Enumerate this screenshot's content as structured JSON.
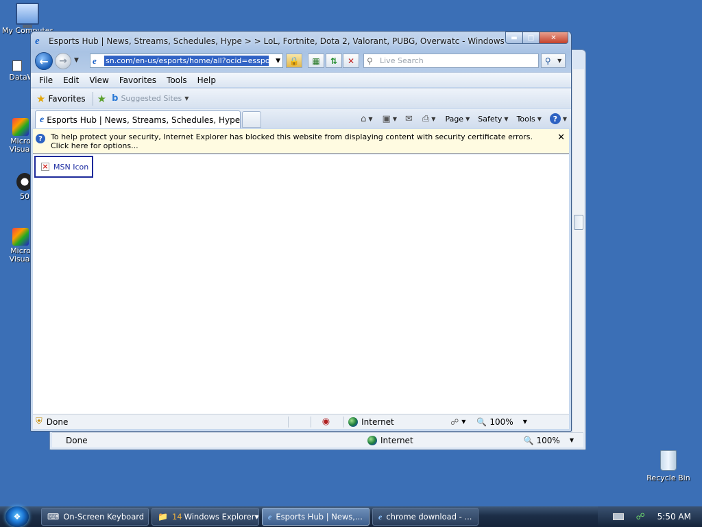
{
  "desktop": {
    "icons": [
      {
        "label": "My Computer",
        "icon": "computer-icon"
      },
      {
        "label": "DataW",
        "icon": "shortcut-icon"
      },
      {
        "label": "Micro\nVisual",
        "icon": "visual-studio-icon"
      },
      {
        "label": "50",
        "icon": "panda-icon"
      },
      {
        "label": "Micro\nVisual",
        "icon": "visual-studio-icon"
      },
      {
        "label": "Recycle Bin",
        "icon": "recycle-bin-icon"
      }
    ]
  },
  "background_window": {
    "status_text": "Done",
    "zone": "Internet",
    "zoom": "100%"
  },
  "browser": {
    "title": "Esports Hub | News, Streams, Schedules, Hype > > LoL, Fortnite, Dota 2, Valorant, PUBG, Overwatc - Windows Internet Exp...",
    "address": "sn.com/en-us/esports/home/all?ocid=essports",
    "search_placeholder": "Live Search",
    "menu": [
      "File",
      "Edit",
      "View",
      "Favorites",
      "Tools",
      "Help"
    ],
    "favorites_label": "Favorites",
    "suggested_sites": "Suggested Sites",
    "tab_title": "Esports Hub | News, Streams, Schedules, Hype > > ...",
    "commands": {
      "page": "Page",
      "safety": "Safety",
      "tools": "Tools"
    },
    "info_bar": "To help protect your security, Internet Explorer has blocked this website from displaying content with security certificate errors. Click here for options...",
    "content": {
      "broken_image_alt": "MSN Icon"
    },
    "status": {
      "text": "Done",
      "zone": "Internet",
      "zoom": "100%"
    }
  },
  "taskbar": {
    "tasks": [
      {
        "label": "On-Screen Keyboard"
      },
      {
        "count": "14",
        "label": "Windows Explorer"
      },
      {
        "label": "Esports Hub | News,..."
      },
      {
        "label": "chrome download - ..."
      }
    ],
    "clock": "5:50 AM"
  }
}
